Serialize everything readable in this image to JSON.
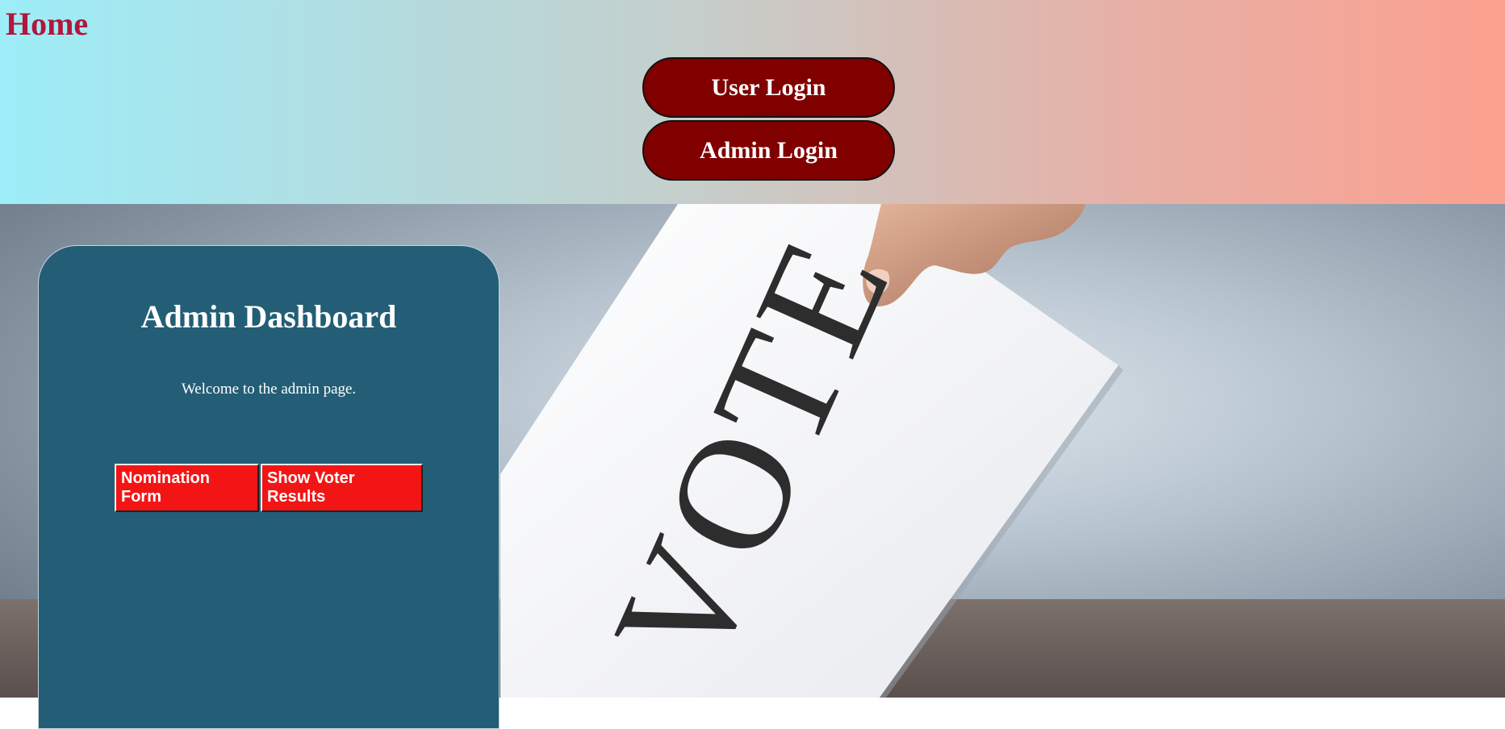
{
  "header": {
    "home_label": "Home",
    "user_login_label": "User Login",
    "admin_login_label": "Admin Login"
  },
  "hero": {
    "ballot_text": "VOTE"
  },
  "panel": {
    "title": "Admin Dashboard",
    "welcome": "Welcome to the admin page.",
    "nomination_label": "Nomination Form",
    "results_label": "Show Voter Results"
  },
  "colors": {
    "header_gradient_start": "#9dedf8",
    "header_gradient_end": "#fca08f",
    "home_text": "#b0173b",
    "pill_button": "#800000",
    "panel_bg": "#235e76",
    "action_button": "#f31515"
  }
}
